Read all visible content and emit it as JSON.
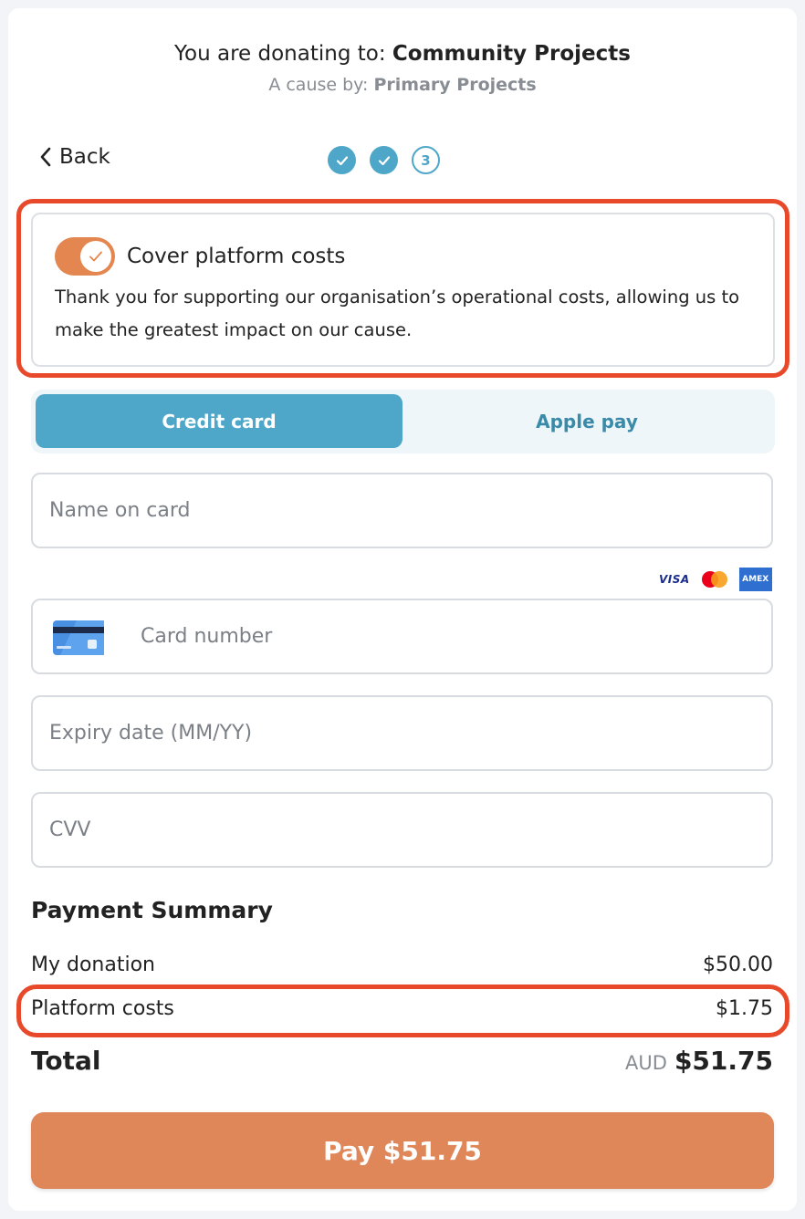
{
  "header": {
    "donating_prefix": "You are donating to:",
    "cause_name": "Community Projects",
    "cause_by_prefix": "A cause by:",
    "organisation": "Primary Projects"
  },
  "nav": {
    "back_label": "Back",
    "steps": [
      {
        "state": "done",
        "label": ""
      },
      {
        "state": "done",
        "label": ""
      },
      {
        "state": "current",
        "label": "3"
      }
    ]
  },
  "cover_costs": {
    "enabled": true,
    "title": "Cover platform costs",
    "description": "Thank you for supporting our organisation’s operational costs, allowing us to make the greatest impact on our cause."
  },
  "payment_tabs": {
    "credit_card": "Credit card",
    "apple_pay": "Apple pay",
    "selected": "credit_card"
  },
  "form": {
    "name_placeholder": "Name on card",
    "card_number_placeholder": "Card number",
    "expiry_placeholder": "Expiry date (MM/YY)",
    "cvv_placeholder": "CVV",
    "brand_icons": [
      "visa-icon",
      "mastercard-icon",
      "amex-icon"
    ],
    "visa_text": "VISA",
    "amex_text": "AMEX"
  },
  "summary": {
    "title": "Payment Summary",
    "donation_label": "My donation",
    "donation_amount": "$50.00",
    "platform_label": "Platform costs",
    "platform_amount": "$1.75",
    "total_label": "Total",
    "currency": "AUD",
    "total_amount": "$51.75"
  },
  "pay_button": "Pay $51.75",
  "colors": {
    "accent_blue": "#4ea7c9",
    "accent_orange": "#e3864f",
    "highlight_red": "#e8492b"
  }
}
